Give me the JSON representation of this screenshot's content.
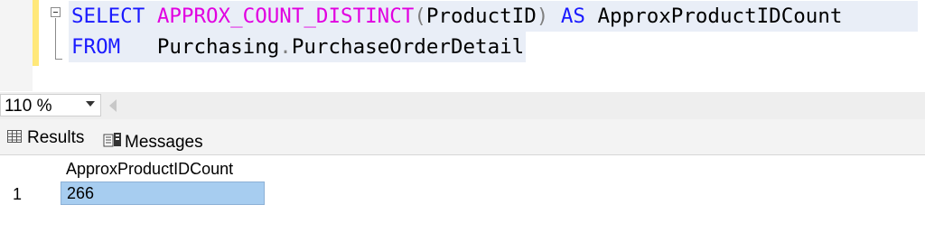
{
  "editor": {
    "line1": {
      "kw_select": "SELECT",
      "fn_name": "APPROX_COUNT_DISTINCT",
      "paren_open": "(",
      "arg": "ProductID",
      "paren_close": ")",
      "kw_as": "AS",
      "alias": "ApproxProductIDCount"
    },
    "line2": {
      "kw_from": "FROM",
      "schema": "Purchasing",
      "dot": ".",
      "table": "PurchaseOrderDetail"
    }
  },
  "zoom": {
    "value": "110 %"
  },
  "tabs": {
    "results_label": "Results",
    "messages_label": "Messages"
  },
  "grid": {
    "columns": [
      "ApproxProductIDCount"
    ],
    "rows": [
      {
        "row_number": "1",
        "cells": [
          "266"
        ]
      }
    ]
  },
  "colors": {
    "keyword": "#1a1aff",
    "function": "#e100e1",
    "selection": "#a7cdf0",
    "change_track": "#ffe87a"
  },
  "icons": {
    "results_tab": "grid-icon",
    "messages_tab": "messages-icon",
    "collapse": "collapse-minus-icon",
    "zoom_dropdown": "chevron-down-icon",
    "scroll": "scroll-left-icon"
  }
}
